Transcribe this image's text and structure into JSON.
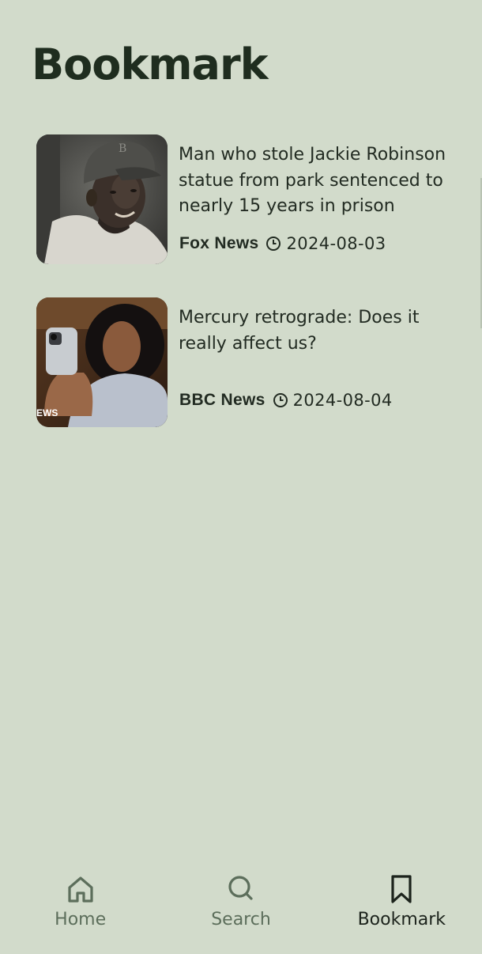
{
  "header": {
    "title": "Bookmark"
  },
  "articles": [
    {
      "headline": "Man who stole Jackie Robinson statue from park sentenced to nearly 15 years in prison",
      "source": "Fox News",
      "date": "2024-08-03",
      "thumbnail": "portrait-baseball-cap-photo"
    },
    {
      "headline": "Mercury retrograde: Does it really affect us?",
      "source": "BBC News",
      "date": "2024-08-04",
      "thumbnail": "woman-selfie-phone-photo"
    }
  ],
  "bottom_nav": {
    "items": [
      {
        "label": "Home",
        "icon": "home-icon",
        "active": false
      },
      {
        "label": "Search",
        "icon": "search-icon",
        "active": false
      },
      {
        "label": "Bookmark",
        "icon": "bookmark-icon",
        "active": true
      }
    ]
  },
  "colors": {
    "background": "#d2dbcb",
    "title": "#1f2d1f",
    "nav_inactive": "#5c6e5b",
    "nav_active": "#1c231c"
  }
}
